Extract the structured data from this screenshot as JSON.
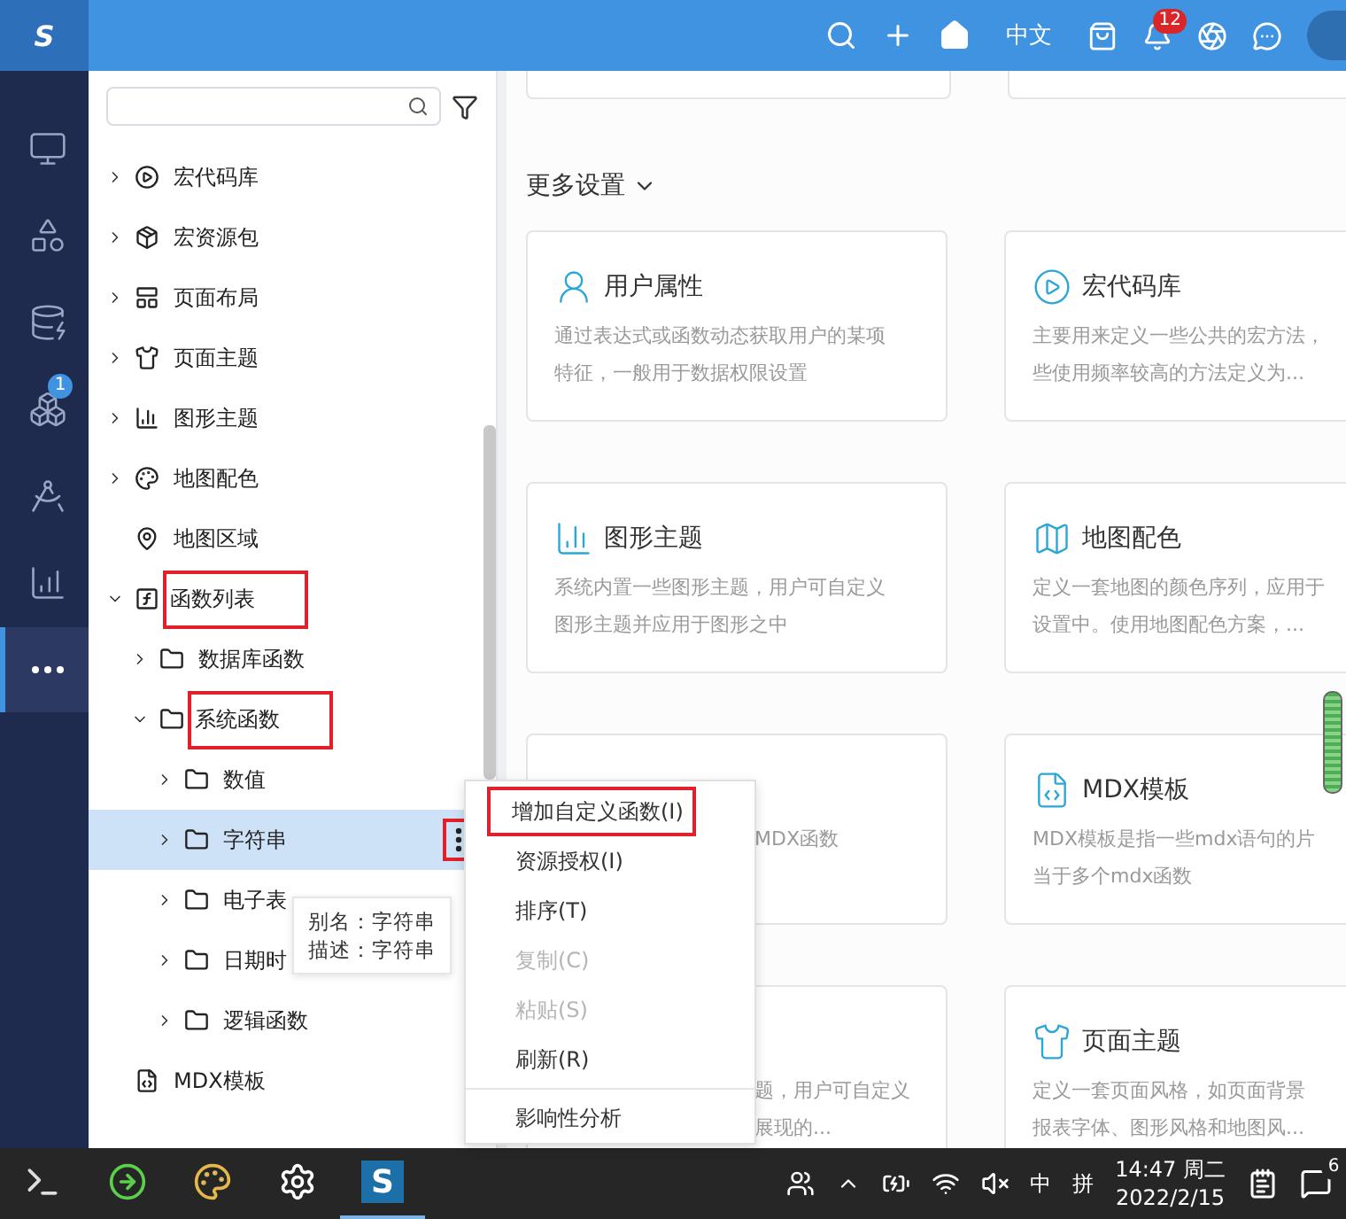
{
  "topbar": {
    "logo": "S",
    "language": "中文",
    "bell_badge": "12"
  },
  "nav": [
    {
      "selected": false
    },
    {
      "selected": false
    },
    {
      "selected": false
    },
    {
      "selected": false,
      "badge": "1"
    },
    {
      "selected": false
    },
    {
      "selected": false
    },
    {
      "selected": true
    }
  ],
  "tree": [
    {
      "label": "宏代码库",
      "kind": "branch",
      "expanded": false,
      "selected": false,
      "highlighted": false
    },
    {
      "label": "宏资源包",
      "kind": "branch",
      "expanded": false,
      "selected": false,
      "highlighted": false
    },
    {
      "label": "页面布局",
      "kind": "branch",
      "expanded": false,
      "selected": false,
      "highlighted": false
    },
    {
      "label": "页面主题",
      "kind": "branch",
      "expanded": false,
      "selected": false,
      "highlighted": false
    },
    {
      "label": "图形主题",
      "kind": "branch",
      "expanded": false,
      "selected": false,
      "highlighted": false
    },
    {
      "label": "地图配色",
      "kind": "branch",
      "expanded": false,
      "selected": false,
      "highlighted": false
    },
    {
      "label": "地图区域",
      "kind": "leaf",
      "selected": false,
      "highlighted": false
    },
    {
      "label": "函数列表",
      "kind": "branch",
      "expanded": true,
      "selected": false,
      "highlighted": true,
      "children": [
        {
          "label": "数据库函数",
          "kind": "branch",
          "expanded": false,
          "selected": false,
          "highlighted": false
        },
        {
          "label": "系统函数",
          "kind": "branch",
          "expanded": true,
          "selected": false,
          "highlighted": true,
          "children": [
            {
              "label": "数值",
              "kind": "branch",
              "expanded": false,
              "selected": false,
              "highlighted": false
            },
            {
              "label": "字符串",
              "kind": "branch",
              "expanded": false,
              "selected": true,
              "highlighted": false
            },
            {
              "label": "电子表",
              "kind": "branch",
              "expanded": false,
              "selected": false,
              "highlighted": false
            },
            {
              "label": "日期时",
              "kind": "branch",
              "expanded": false,
              "selected": false,
              "highlighted": false
            },
            {
              "label": "逻辑函数",
              "kind": "branch",
              "expanded": false,
              "selected": false,
              "highlighted": false
            }
          ]
        }
      ]
    },
    {
      "label": "MDX模板",
      "kind": "leaf",
      "selected": false,
      "highlighted": false
    }
  ],
  "tooltip": [
    "别名：字符串",
    "描述：字符串"
  ],
  "context_menu": [
    {
      "kind": "item",
      "label": "增加自定义函数(I)",
      "disabled": false,
      "highlighted": true
    },
    {
      "kind": "item",
      "label": "资源授权(I)",
      "disabled": false,
      "highlighted": false
    },
    {
      "kind": "item",
      "label": "排序(T)",
      "disabled": false,
      "highlighted": false
    },
    {
      "kind": "item",
      "label": "复制(C)",
      "disabled": true,
      "highlighted": false
    },
    {
      "kind": "item",
      "label": "粘贴(S)",
      "disabled": true,
      "highlighted": false
    },
    {
      "kind": "item",
      "label": "刷新(R)",
      "disabled": false,
      "highlighted": false
    },
    {
      "kind": "separator"
    },
    {
      "kind": "item",
      "label": "影响性分析",
      "disabled": false,
      "highlighted": false
    }
  ],
  "section_title": "更多设置",
  "cards": [
    {
      "title": "用户属性",
      "covered": false,
      "desc": [
        "通过表达式或函数动态获取用户的某项",
        "特征，一般用于数据权限设置"
      ]
    },
    {
      "title": "宏代码库",
      "covered": false,
      "desc": [
        "主要用来定义一些公共的宏方法，",
        "些使用频率较高的方法定义为..."
      ]
    },
    {
      "title": "图形主题",
      "covered": false,
      "desc": [
        "系统内置一些图形主题，用户可自定义",
        "图形主题并应用于图形之中"
      ]
    },
    {
      "title": "地图配色",
      "covered": false,
      "desc": [
        "定义一套地图的颜色序列，应用于",
        "设置中。使用地图配色方案，..."
      ]
    },
    {
      "covered": true,
      "desc": [
        "MDX函数"
      ]
    },
    {
      "title": "MDX模板",
      "covered": false,
      "desc": [
        "MDX模板是指一些mdx语句的片",
        "当于多个mdx函数"
      ]
    },
    {
      "covered": true,
      "desc": [
        "题，用户可自定义",
        "展现的..."
      ]
    },
    {
      "title": "页面主题",
      "covered": false,
      "desc": [
        "定义一套页面风格，如页面背景",
        "报表字体、图形风格和地图风..."
      ]
    }
  ],
  "taskbar": {
    "apps": [
      {
        "selected": false
      },
      {
        "selected": false
      },
      {
        "selected": false
      },
      {
        "selected": false
      },
      {
        "selected": true,
        "label": "S"
      }
    ],
    "ime": "中",
    "ime_mode": "拼",
    "time": "14:47 周二",
    "date": "2022/2/15",
    "notify_badge": "6"
  }
}
